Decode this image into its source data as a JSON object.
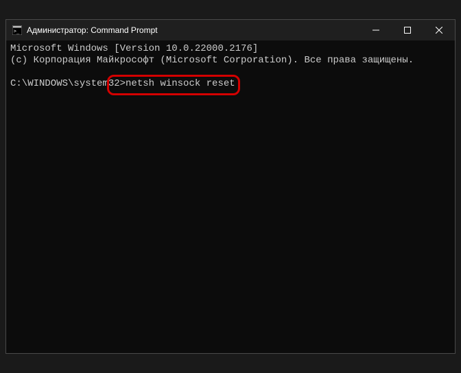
{
  "window": {
    "title": "Администратор: Command Prompt",
    "icon": "cmd-icon"
  },
  "terminal": {
    "line1": "Microsoft Windows [Version 10.0.22000.2176]",
    "line2": "(c) Корпорация Майкрософт (Microsoft Corporation). Все права защищены.",
    "prompt": "C:\\WINDOWS\\system32>",
    "command": "netsh winsock reset"
  }
}
